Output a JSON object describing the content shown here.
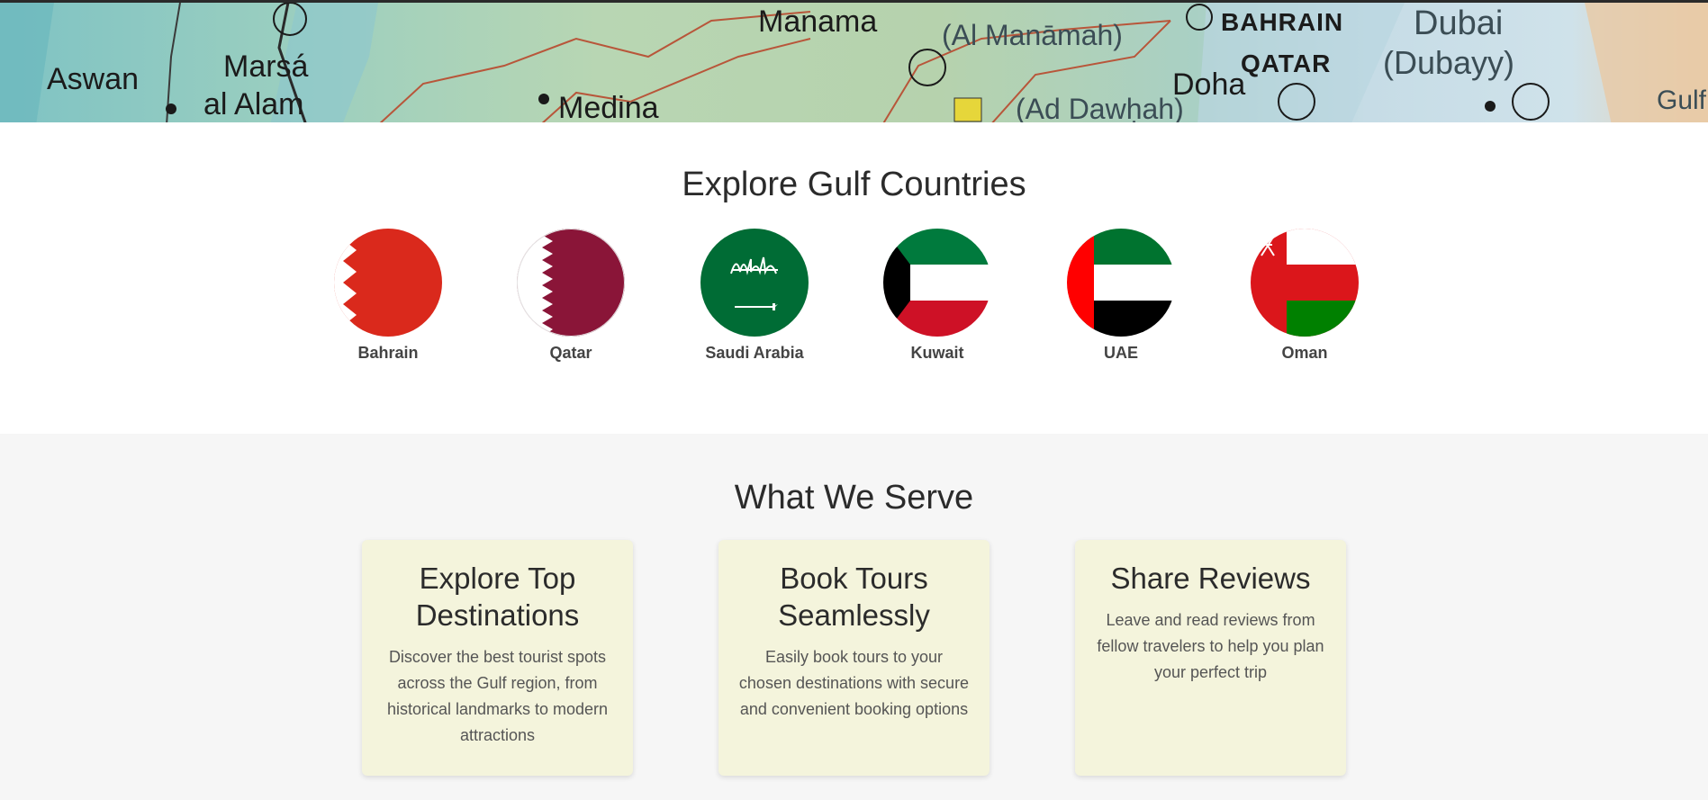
{
  "hero": {
    "map_labels": {
      "aswan": "Aswan",
      "marsa": "Marsá",
      "al_alam": "al Alam",
      "manama": "Manama",
      "al_manamah": "(Al Manāmah)",
      "medina": "Medina",
      "bahrain": "BAHRAIN",
      "qatar": "QATAR",
      "doha": "Doha",
      "ad_dawhah": "(Ad Dawḥah)",
      "dubai": "Dubai",
      "dubayy": "(Dubayy)",
      "gulf": "Gulf"
    }
  },
  "explore": {
    "title": "Explore Gulf Countries",
    "countries": [
      {
        "name": "Bahrain",
        "flag": "bahrain-flag"
      },
      {
        "name": "Qatar",
        "flag": "qatar-flag"
      },
      {
        "name": "Saudi Arabia",
        "flag": "saudi-flag"
      },
      {
        "name": "Kuwait",
        "flag": "kuwait-flag"
      },
      {
        "name": "UAE",
        "flag": "uae-flag"
      },
      {
        "name": "Oman",
        "flag": "oman-flag"
      }
    ]
  },
  "serve": {
    "title": "What We Serve",
    "cards": [
      {
        "title": "Explore Top Destinations",
        "text": "Discover the best tourist spots across the Gulf region, from historical landmarks to modern attractions"
      },
      {
        "title": "Book Tours Seamlessly",
        "text": "Easily book tours to your chosen destinations with secure and convenient booking options"
      },
      {
        "title": "Share Reviews",
        "text": "Leave and read reviews from fellow travelers to help you plan your perfect trip"
      }
    ]
  },
  "colors": {
    "bahrain_red": "#da291c",
    "qatar_maroon": "#8a1538",
    "saudi_green": "#006c35",
    "kuwait_green": "#007a3d",
    "kuwait_red": "#ce1126",
    "uae_red": "#ff0000",
    "uae_green": "#00732f",
    "oman_red": "#db161b",
    "oman_green": "#008000",
    "card_bg": "#f4f4dc",
    "serve_bg": "#f6f6f6"
  }
}
